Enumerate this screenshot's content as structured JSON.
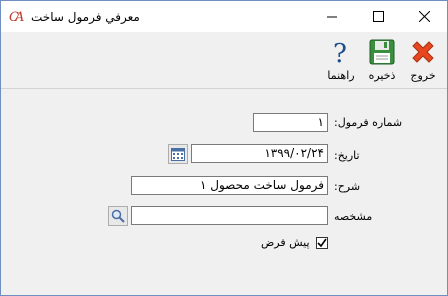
{
  "window": {
    "title": "معرفي فرمول ساخت",
    "logo_text": "CA"
  },
  "toolbar": {
    "exit_label": "خروج",
    "save_label": "ذخیره",
    "help_label": "راهنما"
  },
  "form": {
    "formula_number_label": "شماره فرمول:",
    "formula_number_value": "۱",
    "date_label": "تاریخ:",
    "date_value": "۱۳۹۹/۰۲/۲۴",
    "description_label": "شرح:",
    "description_value": "فرمول ساخت محصول ۱",
    "spec_label": "مشخصه",
    "spec_value": "",
    "default_label": "پیش فرض",
    "default_checked": true
  },
  "icons": {
    "exit": "close-x-icon",
    "save": "floppy-disk-icon",
    "help": "question-mark-icon",
    "calendar": "calendar-icon",
    "search": "magnifier-icon"
  },
  "colors": {
    "exit_red": "#e8461e",
    "save_green": "#2e8b3a",
    "help_blue": "#1f4e8c",
    "logo_red": "#c0392b"
  }
}
